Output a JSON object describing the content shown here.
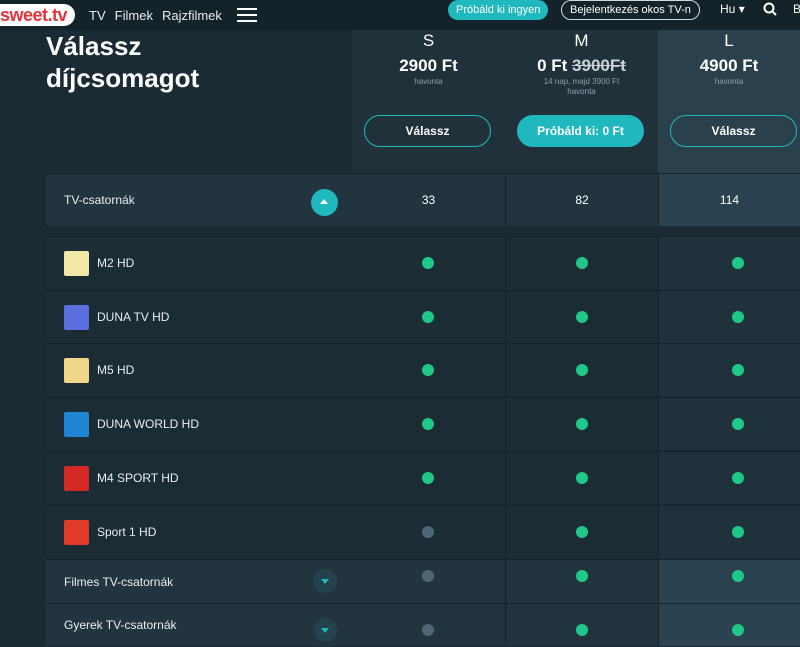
{
  "header": {
    "logo": "sweet.tv",
    "nav": [
      "TV",
      "Filmek",
      "Rajzfilmek"
    ],
    "try_button": "Próbáld ki ingyen",
    "login_button": "Bejelentkezés okos TV-n",
    "language": "Hu",
    "edge_text": "B"
  },
  "page": {
    "title_line1": "Válassz",
    "title_line2": "díjcsomagot"
  },
  "plans": [
    {
      "letter": "S",
      "price": "2900 Ft",
      "old_price": "",
      "note": "havonta",
      "button": "Válassz"
    },
    {
      "letter": "M",
      "price": "0 Ft",
      "old_price": "3900Ft",
      "note_line1": "14 nap, majd 3900 Ft",
      "note": "havonta",
      "button": "Próbáld ki: 0 Ft"
    },
    {
      "letter": "L",
      "price": "4900 Ft",
      "old_price": "",
      "note": "havonta",
      "button": "Válassz"
    }
  ],
  "tv_channels": {
    "label": "TV-csatornák",
    "counts": [
      "33",
      "82",
      "114"
    ]
  },
  "channels": [
    {
      "name": "M2 HD",
      "logo_color": "#f3e7a8",
      "included": [
        true,
        true,
        true
      ]
    },
    {
      "name": "DUNA TV HD",
      "logo_color": "#5b6fe0",
      "included": [
        true,
        true,
        true
      ]
    },
    {
      "name": "M5 HD",
      "logo_color": "#f0d78a",
      "included": [
        true,
        true,
        true
      ]
    },
    {
      "name": "DUNA WORLD HD",
      "logo_color": "#1f86d6",
      "included": [
        true,
        true,
        true
      ]
    },
    {
      "name": "M4 SPORT HD",
      "logo_color": "#d32a26",
      "included": [
        true,
        true,
        true
      ]
    },
    {
      "name": "Sport 1 HD",
      "logo_color": "#e03a2a",
      "included": [
        false,
        true,
        true
      ]
    }
  ],
  "categories": [
    {
      "name": "Filmes TV-csatornák",
      "included": [
        false,
        true,
        true
      ]
    },
    {
      "name": "Gyerek TV-csatornák",
      "included": [
        false,
        true,
        true
      ]
    }
  ],
  "colors": {
    "accent": "#1fb8bf",
    "included": "#20c887",
    "excluded": "#4c6676"
  }
}
